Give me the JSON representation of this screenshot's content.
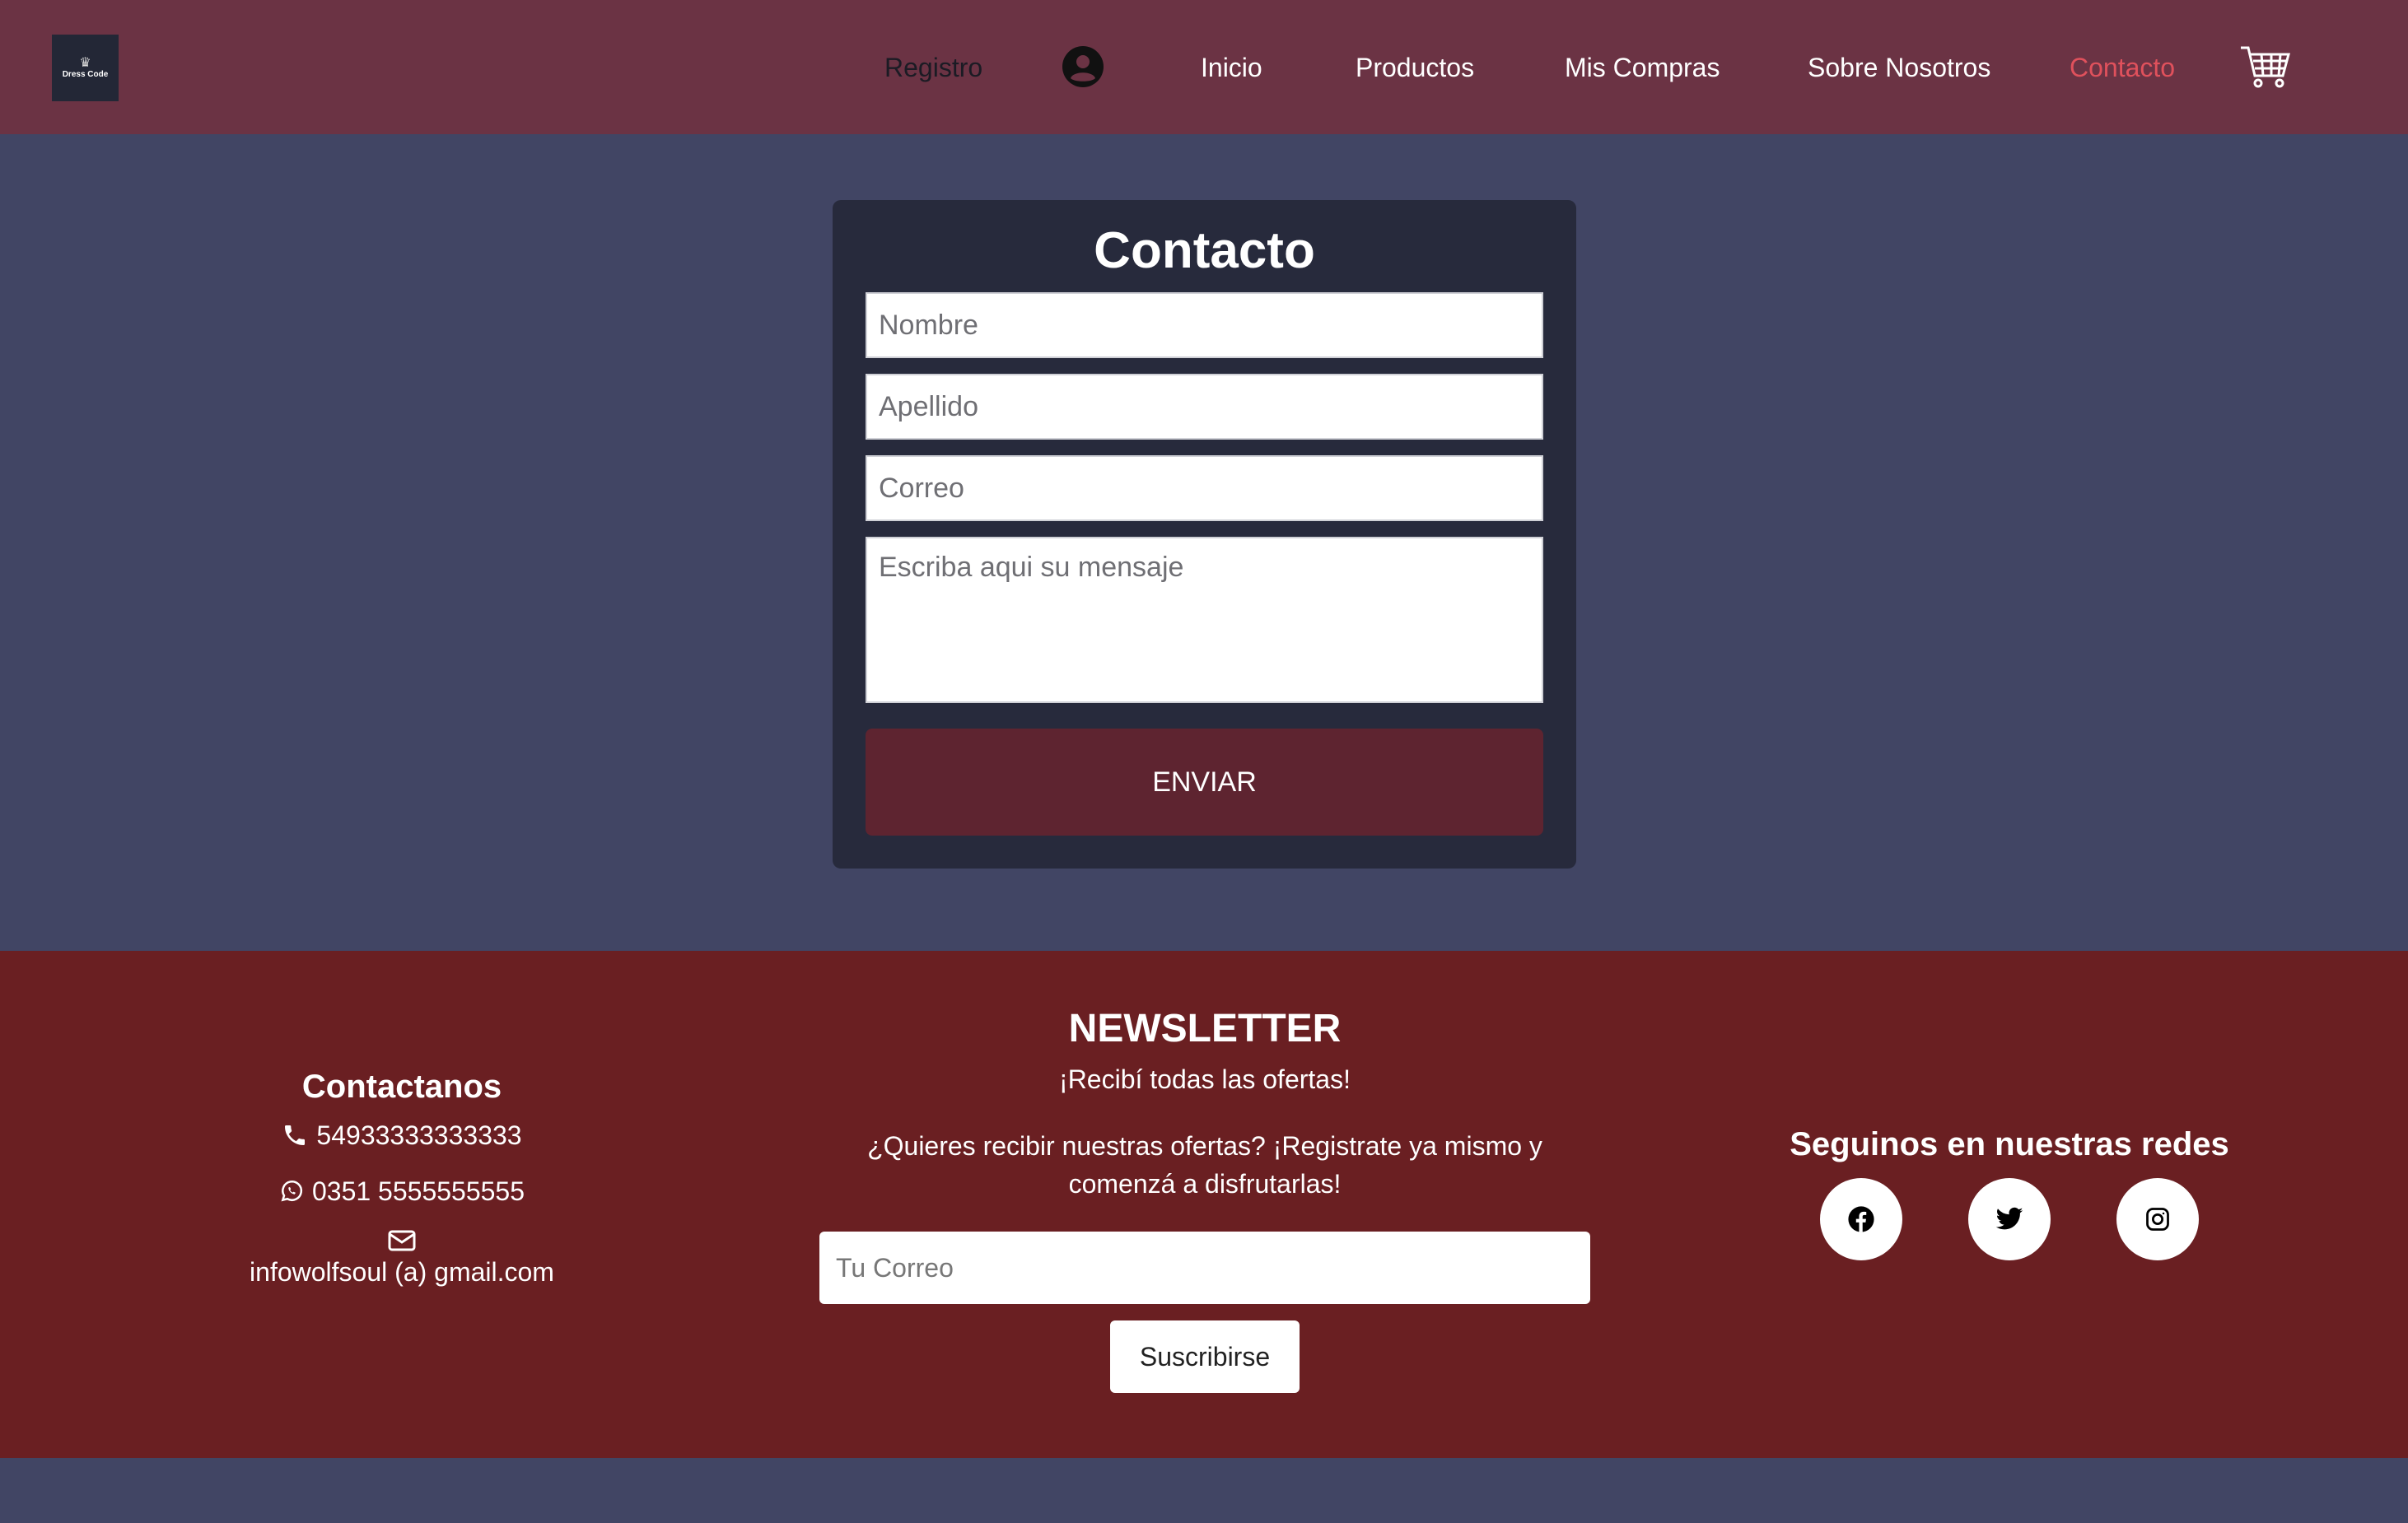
{
  "logo": {
    "brand": "Dress Code"
  },
  "nav": {
    "registro": "Registro",
    "inicio": "Inicio",
    "productos": "Productos",
    "compras": "Mis Compras",
    "sobre": "Sobre Nosotros",
    "contacto": "Contacto",
    "user_icon": "user-circle-icon",
    "cart_icon": "shopping-cart-icon"
  },
  "contact_form": {
    "title": "Contacto",
    "nombre_placeholder": "Nombre",
    "apellido_placeholder": "Apellido",
    "correo_placeholder": "Correo",
    "mensaje_placeholder": "Escriba aqui su mensaje",
    "submit_label": "ENVIAR"
  },
  "footer": {
    "contact": {
      "title": "Contactanos",
      "phone": "54933333333333",
      "whatsapp": "0351 5555555555",
      "email": "infowolfsoul (a) gmail.com"
    },
    "newsletter": {
      "title": "NEWSLETTER",
      "subtitle": "¡Recibí todas las ofertas!",
      "description": "¿Quieres recibir nuestras ofertas? ¡Registrate ya mismo y comenzá a disfrutarlas!",
      "email_placeholder": "Tu Correo",
      "button_label": "Suscribirse"
    },
    "social": {
      "title": "Seguinos en nuestras redes",
      "icons": [
        "facebook-icon",
        "twitter-icon",
        "instagram-icon"
      ]
    }
  },
  "colors": {
    "header_bg": "#6b3344",
    "page_bg": "#414564",
    "card_bg": "#272a3c",
    "button_bg": "#5e2430",
    "footer_bg": "#6a1f22",
    "active_nav": "#e0515c"
  }
}
